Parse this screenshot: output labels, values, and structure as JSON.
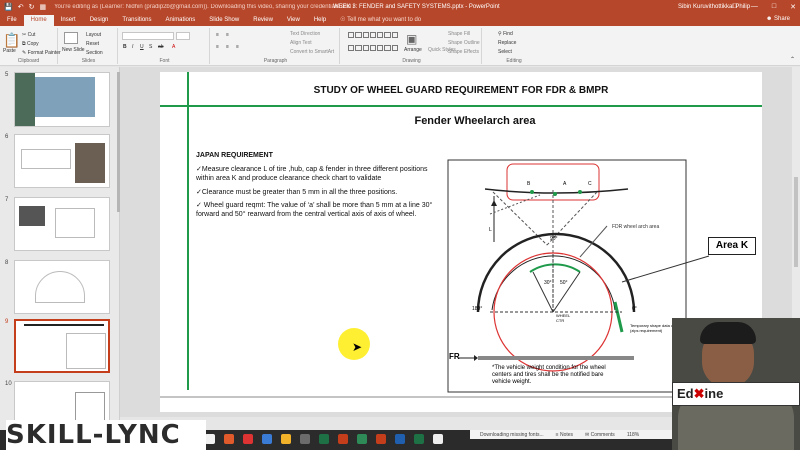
{
  "titlebar": {
    "msg": "You're editing as (Learner: Nidhin (pradip2b@gmail.com)). Downloading this video, sharing your credentials and unauthorized commercial use are strictly prohibited.",
    "document_title": "WEEK 3: FENDER and SAFETY SYSTEMS.pptx - PowerPoint",
    "user": "Sibin Kuruvithottikkal Philip"
  },
  "tabs": [
    "File",
    "Home",
    "Insert",
    "Design",
    "Transitions",
    "Animations",
    "Slide Show",
    "Review",
    "View",
    "Help"
  ],
  "tell_me": "Tell me what you want to do",
  "share": "Share",
  "ribbon": {
    "paste": "Paste",
    "cut": "Cut",
    "copy": "Copy",
    "format_painter": "Format Painter",
    "new_slide": "New Slide",
    "layout": "Layout",
    "reset": "Reset",
    "section": "Section",
    "text_direction": "Text Direction",
    "align_text": "Align Text",
    "convert_smartart": "Convert to SmartArt",
    "arrange": "Arrange",
    "quick_styles": "Quick Styles",
    "shape_fill": "Shape Fill",
    "shape_outline": "Shape Outline",
    "shape_effects": "Shape Effects",
    "find": "Find",
    "replace": "Replace",
    "select": "Select",
    "groups": [
      "Clipboard",
      "Slides",
      "Font",
      "Paragraph",
      "Drawing",
      "Editing"
    ]
  },
  "thumbs": [
    "5",
    "6",
    "7",
    "8",
    "9",
    "10"
  ],
  "slide": {
    "title": "STUDY OF WHEEL GUARD REQUIREMENT FOR FDR & BMPR",
    "subtitle": "Fender Wheelarch area",
    "section_heading": "JAPAN REQUIREMENT",
    "bullet1": "✓Measure  clearance L of tire ,hub, cap & fender in three different positions within area K and produce clearance check chart to validate",
    "bullet2": "✓Clearance must  be greater than 5 mm in all  the three  positions.",
    "bullet3": "✓ Wheel guard reqmt: The value of ‘a’ shall be more than 5 mm at a line 30° forward and 50° rearward from the central vertical axis of axis of wheel.",
    "area_k": "Area K",
    "fr_label": "FR",
    "diagram": {
      "label_fdr": "FDR wheel arch area",
      "label_90": "90°",
      "label_180": "180°",
      "label_0": "0°",
      "label_30": "30°",
      "label_50": "50°",
      "label_wheel": "WHEEL CTR",
      "label_temp": "Temporary shape data on trims (zips requirement)",
      "label_b": "B",
      "label_a": "A",
      "label_c": "C",
      "label_l": "L",
      "note": "*The vehicle weight condition for the wheel centers and tires shall be the notified bare vehicle weight."
    }
  },
  "status": {
    "downloading": "Downloading missing fonts...",
    "notes": "Notes",
    "comments": "Comments",
    "zoom": "118%"
  },
  "overlay": {
    "logo": "SKILL-LYNC",
    "edx_text": "Ed",
    "edx_text2": "ine"
  },
  "colors": {
    "accent": "#b7472a",
    "green_rule": "#1e9a4a"
  }
}
